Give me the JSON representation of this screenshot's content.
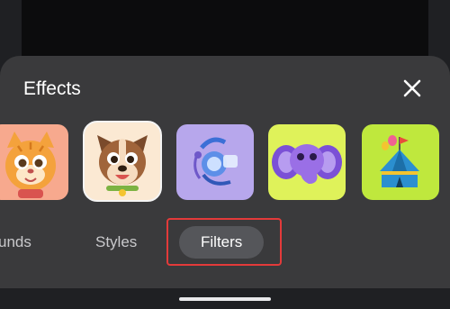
{
  "sheet": {
    "title": "Effects",
    "close_icon": "close-icon"
  },
  "effects": [
    {
      "name": "cat-effect",
      "icon": "cat-face-icon",
      "background": "#f7a98e"
    },
    {
      "name": "dog-effect",
      "icon": "dog-face-icon",
      "background": "#fbe9d3",
      "selected": true
    },
    {
      "name": "diver-effect",
      "icon": "diver-helmet-icon",
      "background": "#b7a7ec"
    },
    {
      "name": "elephant-effect",
      "icon": "elephant-face-icon",
      "background": "#dff25a"
    },
    {
      "name": "circus-tent-effect",
      "icon": "circus-tent-icon",
      "background": "#bfe83d"
    }
  ],
  "tabs": [
    {
      "label": "unds",
      "active": false
    },
    {
      "label": "Styles",
      "active": false
    },
    {
      "label": "Filters",
      "active": true
    }
  ],
  "colors": {
    "sheet_background": "#3a3a3c",
    "active_tab_background": "#55565a",
    "highlight_border": "#e33a3a"
  }
}
